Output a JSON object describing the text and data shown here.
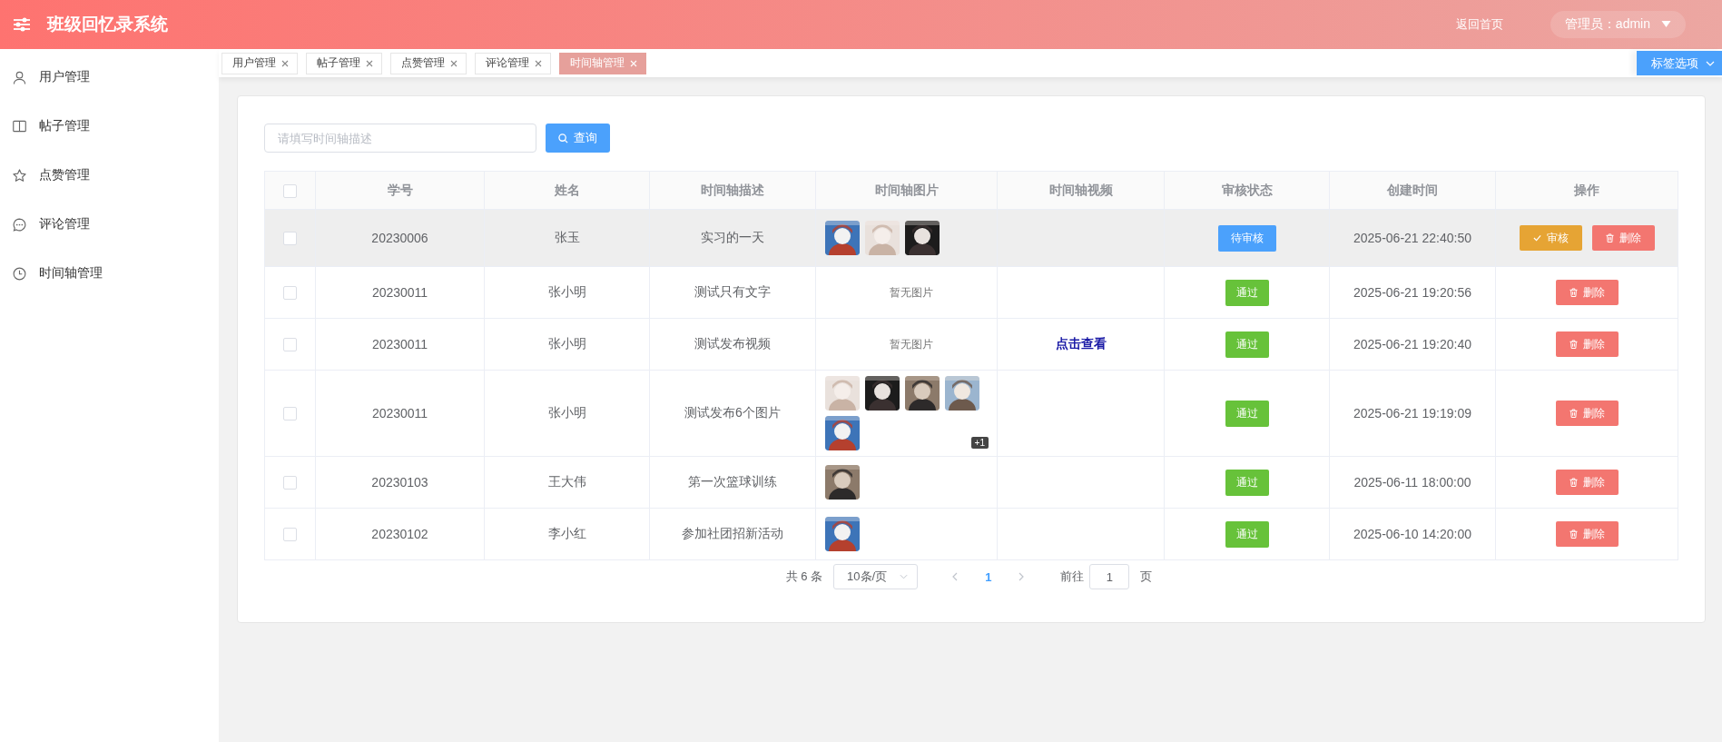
{
  "header": {
    "title": "班级回忆录系统",
    "home_link": "返回首页",
    "user_menu": "管理员：admin"
  },
  "sidebar": {
    "items": [
      {
        "label": "用户管理",
        "kind": "user"
      },
      {
        "label": "帖子管理",
        "kind": "book"
      },
      {
        "label": "点赞管理",
        "kind": "star"
      },
      {
        "label": "评论管理",
        "kind": "comment"
      },
      {
        "label": "时间轴管理",
        "kind": "clock"
      }
    ]
  },
  "tabs": [
    {
      "label": "用户管理",
      "selected": false
    },
    {
      "label": "帖子管理",
      "selected": false
    },
    {
      "label": "点赞管理",
      "selected": false
    },
    {
      "label": "评论管理",
      "selected": false
    },
    {
      "label": "时间轴管理",
      "selected": true
    }
  ],
  "tab_options": "标签选项",
  "search": {
    "placeholder": "请填写时间轴描述",
    "button": "查询"
  },
  "table": {
    "select_all": {
      "checked": false
    },
    "columns": [
      "学号",
      "姓名",
      "时间轴描述",
      "时间轴图片",
      "时间轴视频",
      "审核状态",
      "创建时间",
      "操作"
    ],
    "rows": [
      {
        "checked": false,
        "hover": true,
        "student_id": "20230006",
        "name": "张玉",
        "description": "实习的一天",
        "images": [
          {
            "kind": "picture"
          },
          {
            "kind": "picture"
          },
          {
            "kind": "picture"
          }
        ],
        "status": {
          "kind": "pending",
          "label": "待审核"
        },
        "created": "2025-06-21 22:40:50",
        "actions": [
          {
            "kind": "review",
            "label": "审核"
          },
          {
            "kind": "delete",
            "label": "删除"
          }
        ]
      },
      {
        "checked": false,
        "hover": false,
        "student_id": "20230011",
        "name": "张小明",
        "description": "测试只有文字",
        "no_images": "暂无图片",
        "status": {
          "kind": "approved",
          "label": "通过"
        },
        "created": "2025-06-21 19:20:56",
        "actions": [
          {
            "kind": "delete",
            "label": "删除"
          }
        ]
      },
      {
        "checked": false,
        "hover": false,
        "student_id": "20230011",
        "name": "张小明",
        "description": "测试发布视频",
        "no_images": "暂无图片",
        "video_link": "点击查看",
        "status": {
          "kind": "approved",
          "label": "通过"
        },
        "created": "2025-06-21 19:20:40",
        "actions": [
          {
            "kind": "delete",
            "label": "删除"
          }
        ]
      },
      {
        "checked": false,
        "hover": false,
        "student_id": "20230011",
        "name": "张小明",
        "description": "测试发布6个图片",
        "images": [
          {
            "kind": "picture"
          },
          {
            "kind": "picture"
          },
          {
            "kind": "picture"
          },
          {
            "kind": "picture"
          },
          {
            "kind": "picture"
          }
        ],
        "more_images": "+1",
        "status": {
          "kind": "approved",
          "label": "通过"
        },
        "created": "2025-06-21 19:19:09",
        "actions": [
          {
            "kind": "delete",
            "label": "删除"
          }
        ]
      },
      {
        "checked": false,
        "hover": false,
        "student_id": "20230103",
        "name": "王大伟",
        "description": "第一次篮球训练",
        "images": [
          {
            "kind": "picture"
          }
        ],
        "status": {
          "kind": "approved",
          "label": "通过"
        },
        "created": "2025-06-11 18:00:00",
        "actions": [
          {
            "kind": "delete",
            "label": "删除"
          }
        ]
      },
      {
        "checked": false,
        "hover": false,
        "student_id": "20230102",
        "name": "李小红",
        "description": "参加社团招新活动",
        "images": [
          {
            "kind": "picture"
          }
        ],
        "status": {
          "kind": "approved",
          "label": "通过"
        },
        "created": "2025-06-10 14:20:00",
        "actions": [
          {
            "kind": "delete",
            "label": "删除"
          }
        ]
      }
    ]
  },
  "pagination": {
    "total": "共 6 条",
    "page_size": "10条/页",
    "pages": [
      {
        "label": "1",
        "selected": true
      }
    ],
    "goto_label": "前往",
    "goto_value": "1",
    "goto_suffix": "页"
  }
}
